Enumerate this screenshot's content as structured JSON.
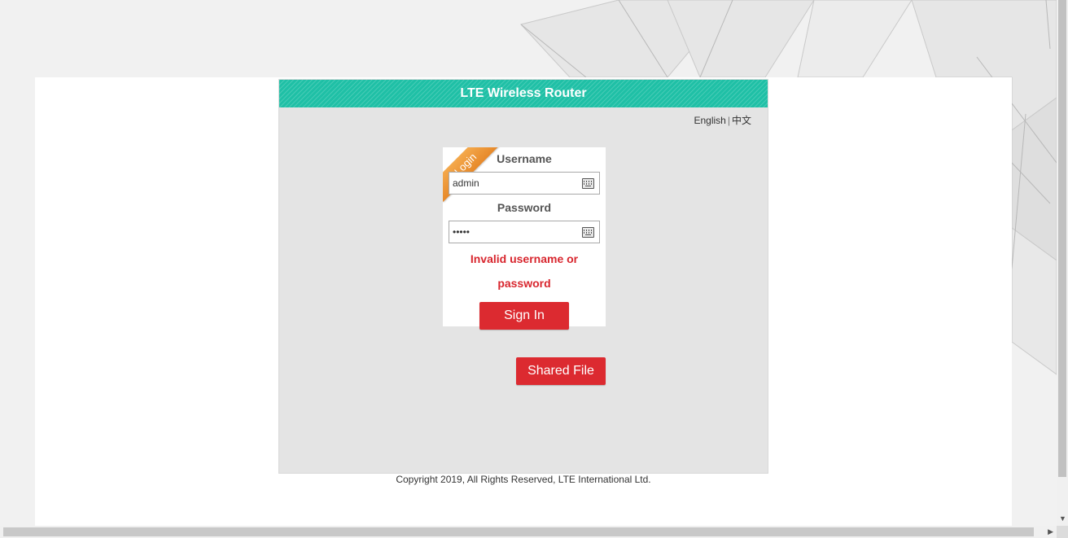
{
  "header": {
    "title": "LTE Wireless Router"
  },
  "language": {
    "english": "English",
    "separator": "|",
    "chinese": "中文"
  },
  "login": {
    "ribbon_label": "Login",
    "username_label": "Username",
    "username_value": "admin",
    "password_label": "Password",
    "password_value": "admin",
    "error_message": "Invalid username or password",
    "sign_in_label": "Sign In"
  },
  "shared_file_label": "Shared File",
  "footer": {
    "copyright": "Copyright 2019, All Rights Reserved, LTE International Ltd."
  },
  "icons": {
    "keyboard": "keyboard-icon"
  },
  "colors": {
    "header": "#1fc0a6",
    "button": "#dc2a30",
    "error": "#d8262e",
    "ribbon": "#f0a040",
    "frame": "#e4e4e4"
  }
}
